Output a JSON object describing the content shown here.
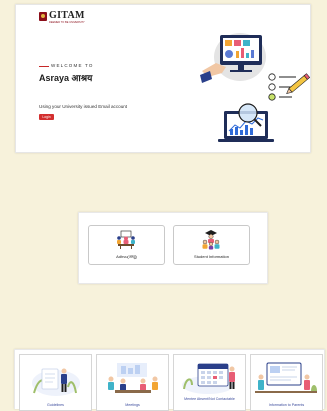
{
  "login": {
    "logo": {
      "name": "GITAM",
      "tagline": "DEEMED TO BE UNIVERSITY"
    },
    "welcome": "WELCOME TO",
    "title": "Asraya आश्रय",
    "hint": "Using your University issued Email account",
    "button": "Login"
  },
  "modules": [
    {
      "label": "Adhvu(अध्वु)",
      "icon": "meeting-people-icon"
    },
    {
      "label": "Student Information",
      "icon": "students-group-icon"
    }
  ],
  "tiles": [
    {
      "label": "Guidelines",
      "icon": "guidelines-illustration"
    },
    {
      "label": "Meetings",
      "icon": "meetings-illustration"
    },
    {
      "label": "Mentee Absent/Not Contactable",
      "icon": "calendar-illustration"
    },
    {
      "label": "Information to Parents",
      "icon": "parents-info-illustration"
    }
  ],
  "colors": {
    "background": "#f7f2db",
    "accent": "#d32f2f",
    "tile_text": "#3a4a9c"
  }
}
